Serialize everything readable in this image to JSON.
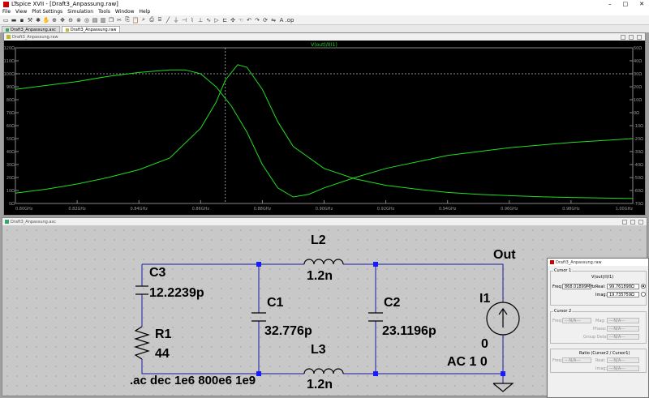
{
  "app": {
    "title": "LTspice XVII - [Draft3_Anpassung.raw]"
  },
  "menu": [
    "File",
    "View",
    "Plot Settings",
    "Simulation",
    "Tools",
    "Window",
    "Help"
  ],
  "tabs": [
    {
      "label": "Draft3_Anpassung.asc",
      "active": false
    },
    {
      "label": "Draft3_Anpassung.raw",
      "active": true
    }
  ],
  "plot_window": {
    "title": "Draft3_Anpassung.raw",
    "trace_label": "V(out)/I(I1)"
  },
  "schematic_window": {
    "title": "Draft3_Anpassung.asc"
  },
  "schematic": {
    "c3_name": "C3",
    "c3_value": "12.2239p",
    "r1_name": "R1",
    "r1_value": "44",
    "l2_name": "L2",
    "l2_value": "1.2n",
    "l3_name": "L3",
    "l3_value": "1.2n",
    "c1_name": "C1",
    "c1_value": "32.776p",
    "c2_name": "C2",
    "c2_value": "23.1196p",
    "i1_name": "I1",
    "i1_value": "0",
    "i1_ac": "AC 1 0",
    "out_label": "Out",
    "directive": ".ac dec 1e6 800e6 1e9"
  },
  "cursor_dialog": {
    "title": "Draft3_Anpassung.raw",
    "cursor1_label": "Cursor 1",
    "trace": "V(out)/I(I1)",
    "freq_label": "Freq:",
    "freq_value": "868.01899MHz",
    "real_label": "Real:",
    "real_value": "99.761898Ω",
    "imag_label": "Imag:",
    "imag_value": "19.735759Ω",
    "cursor2_label": "Cursor 2",
    "na": "---N/A---",
    "mag_label": "Mag:",
    "phase_label": "Phase:",
    "group_delay_label": "Group Delay:",
    "ratio_label": "Ratio (Cursor2 / Cursor1)"
  },
  "chart_data": {
    "type": "line",
    "x_label_unit": "GHz",
    "xlim": [
      0.8,
      1.0
    ],
    "x_ticks": [
      "0.80GHz",
      "0.82GHz",
      "0.84GHz",
      "0.86GHz",
      "0.88GHz",
      "0.90GHz",
      "0.92GHz",
      "0.94GHz",
      "0.96GHz",
      "0.98GHz",
      "1.00GHz"
    ],
    "y_left_ticks": [
      "0Ω",
      "10Ω",
      "20Ω",
      "30Ω",
      "40Ω",
      "50Ω",
      "60Ω",
      "70Ω",
      "80Ω",
      "90Ω",
      "100Ω",
      "110Ω",
      "120Ω"
    ],
    "y_left_lim": [
      0,
      120
    ],
    "y_right_ticks": [
      "-70Ω",
      "-60Ω",
      "-50Ω",
      "-40Ω",
      "-30Ω",
      "-20Ω",
      "-10Ω",
      "0Ω",
      "10Ω",
      "20Ω",
      "30Ω",
      "40Ω",
      "50Ω"
    ],
    "y_right_lim": [
      -70,
      50
    ],
    "cursor_x": 0.868,
    "reference_y": 100,
    "series": [
      {
        "axis": "left",
        "x": [
          0.8,
          0.81,
          0.82,
          0.83,
          0.84,
          0.85,
          0.86,
          0.865,
          0.868,
          0.872,
          0.875,
          0.88,
          0.885,
          0.89,
          0.9,
          0.91,
          0.92,
          0.93,
          0.94,
          0.95,
          0.96,
          0.97,
          0.98,
          0.99,
          1.0
        ],
        "y": [
          8,
          11,
          15,
          20,
          26,
          35,
          58,
          78,
          95,
          107,
          105,
          88,
          63,
          44,
          27,
          19,
          14,
          11,
          8.5,
          7,
          6,
          5.2,
          4.6,
          4.2,
          3.8
        ]
      },
      {
        "axis": "right",
        "x": [
          0.8,
          0.81,
          0.82,
          0.83,
          0.84,
          0.85,
          0.855,
          0.86,
          0.865,
          0.87,
          0.875,
          0.88,
          0.885,
          0.89,
          0.895,
          0.9,
          0.91,
          0.92,
          0.94,
          0.96,
          0.98,
          1.0
        ],
        "y": [
          18,
          21,
          24,
          28,
          31,
          33,
          33,
          30,
          20,
          5,
          -15,
          -40,
          -58,
          -65,
          -63,
          -58,
          -50,
          -43,
          -33,
          -27,
          -23,
          -20
        ]
      }
    ]
  }
}
